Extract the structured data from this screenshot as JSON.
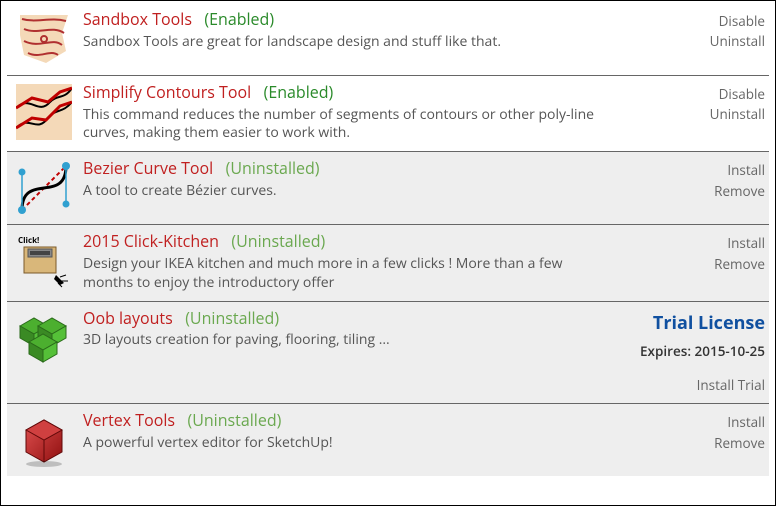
{
  "status_labels": {
    "enabled": "(Enabled)",
    "uninstalled": "(Uninstalled)"
  },
  "action_labels": {
    "disable": "Disable",
    "uninstall": "Uninstall",
    "install": "Install",
    "remove": "Remove",
    "install_trial": "Install Trial"
  },
  "trial": {
    "title": "Trial License",
    "expires_label": "Expires:",
    "expires_value": "2015-10-25"
  },
  "extensions": [
    {
      "name": "Sandbox Tools",
      "status": "enabled",
      "desc": "Sandbox Tools are great for landscape design and stuff like that.",
      "icon": "sandbox"
    },
    {
      "name": "Simplify Contours Tool",
      "status": "enabled",
      "desc": "This command reduces the number of segments of contours or other poly-line curves, making them easier to work with.",
      "icon": "simplify"
    },
    {
      "name": "Bezier Curve Tool",
      "status": "uninstalled",
      "desc": "A tool to create Bézier curves.",
      "icon": "bezier"
    },
    {
      "name": "2015 Click-Kitchen",
      "status": "uninstalled",
      "desc": "Design your IKEA kitchen and much more in a few clicks ! More than a few months to enjoy the introductory offer",
      "icon": "kitchen"
    },
    {
      "name": "Oob layouts",
      "status": "uninstalled",
      "desc": "3D layouts creation for paving, flooring, tiling ...",
      "icon": "oob",
      "trial": true
    },
    {
      "name": "Vertex Tools",
      "status": "uninstalled",
      "desc": "A powerful vertex editor for SketchUp!",
      "icon": "vertex"
    }
  ]
}
